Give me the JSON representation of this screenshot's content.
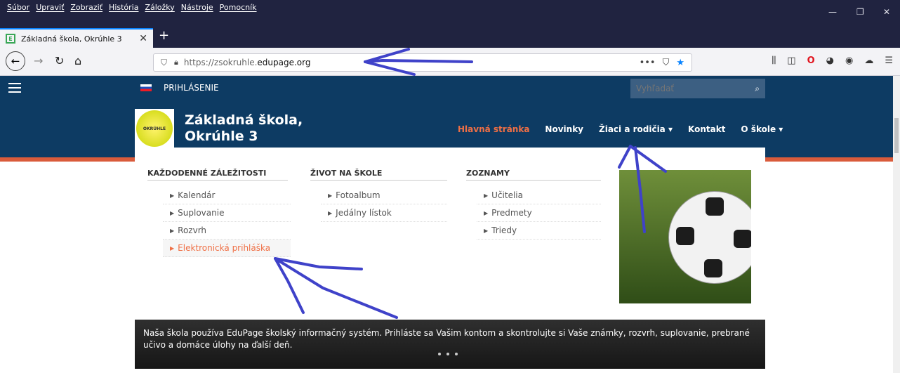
{
  "browser": {
    "menu": [
      "Súbor",
      "Upraviť",
      "Zobraziť",
      "História",
      "Záložky",
      "Nástroje",
      "Pomocník"
    ],
    "tab_title": "Základná škola, Okrúhle 3",
    "tab_favicon": "E",
    "url_prefix": "https://zsokruhle.",
    "url_domain": "edupage.org",
    "icons": [
      "back-icon",
      "forward-icon",
      "reload-icon",
      "home-icon",
      "shield-icon",
      "lock-icon",
      "more-icon",
      "pocket-icon",
      "bookmark-star-icon",
      "library-icon",
      "sidebar-icon",
      "opera-icon",
      "extension-icon",
      "account-icon",
      "sync-icon",
      "menu-icon"
    ]
  },
  "site": {
    "login_label": "PRIHLÁSENIE",
    "search_placeholder": "Vyhľadať",
    "school_name": "Základná škola, Okrúhle 3",
    "logo_text": "OKRÚHLE",
    "nav": [
      {
        "label": "Hlavná stránka"
      },
      {
        "label": "Novinky"
      },
      {
        "label": "Žiaci a rodičia ▾"
      },
      {
        "label": "Kontakt"
      },
      {
        "label": "O škole ▾"
      }
    ],
    "dropdown": {
      "columns": [
        {
          "heading": "KAŽDODENNÉ ZÁLEŽITOSTI",
          "items": [
            "Kalendár",
            "Suplovanie",
            "Rozvrh",
            "Elektronická prihláška"
          ]
        },
        {
          "heading": "ŽIVOT NA ŠKOLE",
          "items": [
            "Fotoalbum",
            "Jedálny lístok"
          ]
        },
        {
          "heading": "ZOZNAMY",
          "items": [
            "Učitelia",
            "Predmety",
            "Triedy"
          ]
        }
      ]
    },
    "banner_text": "Naša škola používa EduPage školský informačný systém. Prihláste sa Vašim kontom a skontrolujte si Vaše známky, rozvrh, suplovanie, prebrané učivo a domáce úlohy na ďalší deň.",
    "accent_color": "#ef6f45",
    "header_color": "#0d3b63"
  }
}
